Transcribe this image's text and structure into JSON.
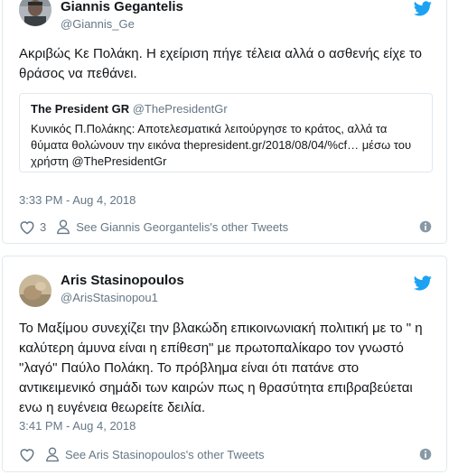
{
  "tweets": [
    {
      "author_name": "Giannis Gegantelis",
      "author_handle": "@Giannis_Ge",
      "text": "Ακριβώς Κε Πολάκη. Η εχείριση πήγε τέλεια αλλά ο ασθενής είχε το θράσος να πεθάνει.",
      "quote": {
        "author_name": "The President GR",
        "author_handle": "@ThePresidentGr",
        "text": "Κυνικός Π.Πολάκης: Αποτελεσματικά λειτούργησε το κράτος, αλλά τα θύματα θολώνουν την εικόνα thepresident.gr/2018/08/04/%cf… μέσω του χρήστη @ThePresidentGr"
      },
      "timestamp": "3:33 PM - Aug 4, 2018",
      "like_count": "3",
      "other_tweets_label": "See Giannis Georgantelis's other Tweets"
    },
    {
      "author_name": "Aris Stasinopoulos",
      "author_handle": "@ArisStasinopou1",
      "text": "Το Μαξίμου συνεχίζει την βλακώδη επικοινωνιακή πολιτική με το \" η καλύτερη άμυνα είναι η επίθεση\" με πρωτοπαλίκαρο τον γνωστό \"λαγό\" Παύλο Πολάκη. Το πρόβλημα είναι ότι πατάνε στο αντικειμενικό σημάδι των καιρών πως η θρασύτητα επιβραβεύεται ενω η ευγένεια θεωρείτε δειλία.",
      "timestamp": "3:41 PM - Aug 4, 2018",
      "other_tweets_label": "See Aris Stasinopoulos's other Tweets"
    }
  ],
  "colors": {
    "twitter_blue": "#1da1f2",
    "secondary_text": "#657786",
    "border": "#e1e8ed"
  }
}
